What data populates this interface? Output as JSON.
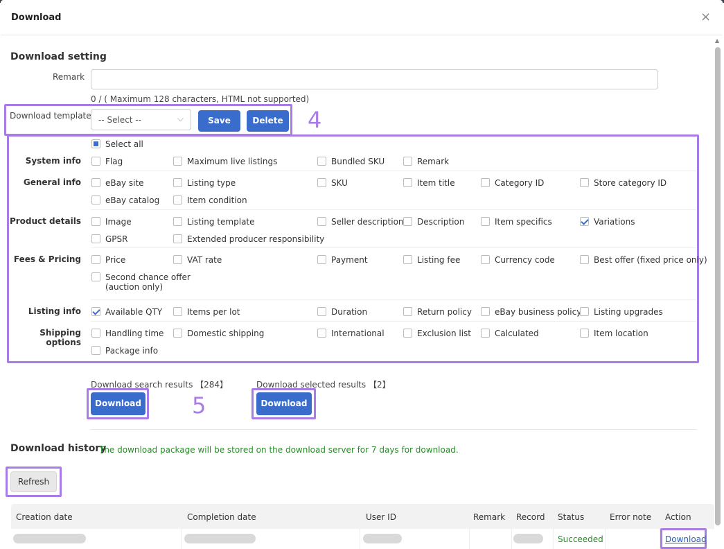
{
  "dialog": {
    "title": "Download",
    "close_symbol": "×"
  },
  "settings": {
    "section_title": "Download setting",
    "remark_label": "Remark",
    "remark_value": "",
    "remark_hint": "0 / ( Maximum 128 characters, HTML not supported)",
    "template_label": "Download template",
    "template_select_value": "-- Select --",
    "save_label": "Save",
    "delete_label": "Delete",
    "annotation_4": "4",
    "select_all": "Select all",
    "groups": [
      {
        "name": "System info",
        "items": [
          "Flag",
          "Maximum live listings",
          "Bundled SKU",
          "Remark"
        ],
        "checked": []
      },
      {
        "name": "General info",
        "items": [
          "eBay site",
          "Listing type",
          "SKU",
          "Item title",
          "Category ID",
          "Store category ID",
          "eBay catalog",
          "Item condition"
        ],
        "checked": []
      },
      {
        "name": "Product details",
        "items": [
          "Image",
          "Listing template",
          "Seller description",
          "Description",
          "Item specifics",
          "Variations",
          "GPSR",
          "Extended producer responsibility"
        ],
        "checked": [
          "Variations"
        ]
      },
      {
        "name": "Fees & Pricing",
        "items": [
          "Price",
          "VAT rate",
          "Payment",
          "Listing fee",
          "Currency code",
          "Best offer (fixed price only)",
          "Second chance offer (auction only)"
        ],
        "checked": []
      },
      {
        "name": "Listing info",
        "items": [
          "Available QTY",
          "Items per lot",
          "Duration",
          "Return policy",
          "eBay business policy",
          "Listing upgrades"
        ],
        "checked": [
          "Available QTY"
        ]
      },
      {
        "name": "Shipping options",
        "items": [
          "Handling time",
          "Domestic shipping",
          "International",
          "Exclusion list",
          "Calculated",
          "Item location",
          "Package info"
        ],
        "checked": []
      }
    ]
  },
  "download": {
    "search_results_label": "Download search results 【284】",
    "selected_results_label": "Download selected results 【2】",
    "search_button": "Download",
    "selected_button": "Download",
    "annotation_5": "5"
  },
  "history": {
    "section_title": "Download history",
    "note": "The download package will be stored on the download server for 7 days for download.",
    "refresh_label": "Refresh",
    "columns": [
      "Creation date",
      "Completion date",
      "User ID",
      "Remark",
      "Record",
      "Status",
      "Error note",
      "Action"
    ],
    "rows": [
      {
        "status": "Succeeded",
        "action": "Download"
      }
    ]
  },
  "colors": {
    "primary": "#3a6ccc",
    "highlight": "#a97be6",
    "success": "#2a8a2a"
  }
}
